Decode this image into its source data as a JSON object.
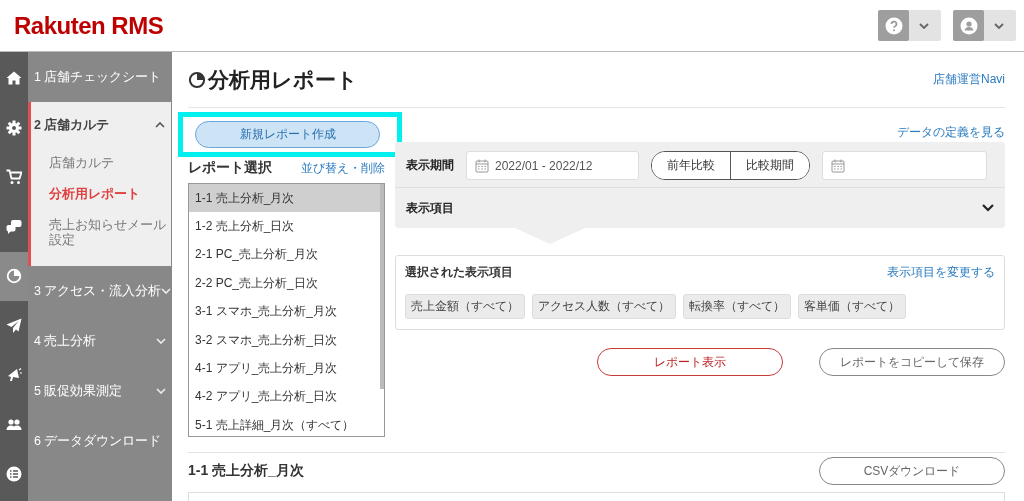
{
  "header": {
    "logo": "Rakuten RMS"
  },
  "rail": [
    {
      "selected": false
    },
    {
      "selected": false
    },
    {
      "selected": false
    },
    {
      "selected": false
    },
    {
      "selected": true
    },
    {
      "selected": false
    },
    {
      "selected": false
    },
    {
      "selected": false
    },
    {
      "selected": false
    }
  ],
  "sidebar": {
    "items": [
      {
        "label": "1 店舗チェックシート",
        "kind": "link"
      },
      {
        "label": "2 店舗カルテ",
        "kind": "group",
        "expanded": true,
        "children": [
          {
            "label": "店舗カルテ",
            "selected": false
          },
          {
            "label": "分析用レポート",
            "selected": true
          },
          {
            "label": "売上お知らせメール設定",
            "selected": false
          }
        ]
      },
      {
        "label": "3 アクセス・流入分析",
        "kind": "group",
        "expanded": false
      },
      {
        "label": "4 売上分析",
        "kind": "group",
        "expanded": false
      },
      {
        "label": "5 販促効果測定",
        "kind": "group",
        "expanded": false
      },
      {
        "label": "6 データダウンロード",
        "kind": "link"
      }
    ]
  },
  "page": {
    "title": "分析用レポート",
    "navi_link": "店舗運営Navi"
  },
  "new_report_button": "新規レポート作成",
  "report_select": {
    "title": "レポート選択",
    "sort_link": "並び替え・削除",
    "items": [
      {
        "label": "1-1 売上分析_月次",
        "selected": true
      },
      {
        "label": "1-2 売上分析_日次",
        "selected": false
      },
      {
        "label": "2-1 PC_売上分析_月次",
        "selected": false
      },
      {
        "label": "2-2 PC_売上分析_日次",
        "selected": false
      },
      {
        "label": "3-1 スマホ_売上分析_月次",
        "selected": false
      },
      {
        "label": "3-2 スマホ_売上分析_日次",
        "selected": false
      },
      {
        "label": "4-1 アプリ_売上分析_月次",
        "selected": false
      },
      {
        "label": "4-2 アプリ_売上分析_日次",
        "selected": false
      },
      {
        "label": "5-1 売上詳細_月次（すべて）",
        "selected": false
      }
    ]
  },
  "definition_link": "データの定義を見る",
  "period": {
    "label": "表示期間",
    "value": "2022/01 - 2022/12",
    "compare": [
      {
        "label": "前年比較",
        "selected": false
      },
      {
        "label": "比較期間",
        "selected": false
      }
    ]
  },
  "display_items": {
    "label": "表示項目",
    "expanded": false
  },
  "selected_items": {
    "title": "選択された表示項目",
    "change_link": "表示項目を変更する",
    "chips": [
      "売上金額（すべて）",
      "アクセス人数（すべて）",
      "転換率（すべて）",
      "客単価（すべて）"
    ]
  },
  "actions": {
    "show": "レポート表示",
    "copy": "レポートをコピーして保存"
  },
  "result": {
    "title": "1-1 売上分析_月次",
    "csv_button": "CSVダウンロード"
  }
}
